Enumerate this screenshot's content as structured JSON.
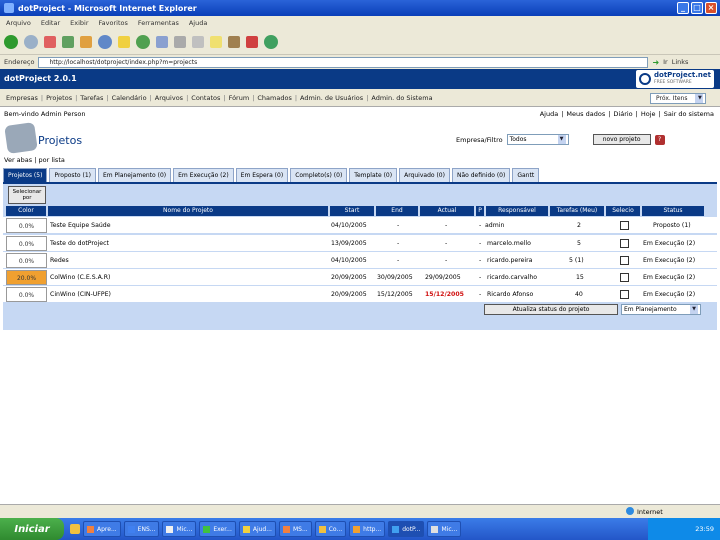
{
  "window": {
    "title": "dotProject - Microsoft Internet Explorer",
    "min": "_",
    "max": "□",
    "close": "×"
  },
  "ie_menu": [
    "Arquivo",
    "Editar",
    "Exibir",
    "Favoritos",
    "Ferramentas",
    "Ajuda"
  ],
  "address": {
    "label": "Endereço",
    "url": "http://localhost/dotproject/index.php?m=projects",
    "go": "Ir",
    "links": "Links"
  },
  "app": {
    "name": "dotProject 2.0.1",
    "logo": "dotProject.net",
    "logo_sub": "FREE SOFTWARE"
  },
  "nav": [
    "Empresas",
    "Projetos",
    "Tarefas",
    "Calendário",
    "Arquivos",
    "Contatos",
    "Fórum",
    "Chamados",
    "Admin. de Usuários",
    "Admin. do Sistema",
    "Próx. Itens"
  ],
  "user": {
    "welcome": "Bem-vindo Admin Person",
    "links": [
      "Ajuda",
      "Meus dados",
      "Diário",
      "Hoje",
      "Sair do sistema"
    ]
  },
  "page": {
    "title": "Projetos",
    "filter_label": "Empresa/Filtro",
    "filter_value": "Todos",
    "new_button": "novo projeto",
    "help": "?"
  },
  "view_line": "Ver abas | por lista",
  "tabs": [
    "Projetos (5)",
    "Proposto (1)",
    "Em Planejamento (0)",
    "Em Execução (2)",
    "Em Espera (0)",
    "Completo(s) (0)",
    "Template (0)",
    "Arquivado (0)",
    "Não definido (0)",
    "Gantt"
  ],
  "table": {
    "sort_label": "Selecionar por",
    "headers": [
      "Color",
      "Nome do Projeto",
      "Start",
      "End",
      "Actual",
      "P",
      "Responsável",
      "Tarefas (Meu)",
      "Selecio",
      "Status"
    ],
    "rows": [
      {
        "color_text": "0.0%",
        "color": "#ffffff",
        "name": "Teste Equipe Saúde",
        "start": "04/10/2005",
        "end": "-",
        "actual": "-",
        "p": "-",
        "owner": "admin",
        "tasks": "2",
        "status": "Proposto (1)"
      },
      {
        "color_text": "0.0%",
        "color": "#ffffff",
        "name": "Teste do dotProject",
        "start": "13/09/2005",
        "end": "-",
        "actual": "-",
        "p": "-",
        "owner": "marcelo.mello",
        "tasks": "5",
        "status": "Em Execução (2)"
      },
      {
        "color_text": "0.0%",
        "color": "#ffffff",
        "name": "Redes",
        "start": "04/10/2005",
        "end": "-",
        "actual": "-",
        "p": "-",
        "owner": "ricardo.pereira",
        "tasks": "5 (1)",
        "status": "Em Execução (2)"
      },
      {
        "color_text": "20.0%",
        "color": "#f0a030",
        "name": "ColWino (C.E.S.A.R)",
        "start": "20/09/2005",
        "end": "30/09/2005",
        "actual": "29/09/2005",
        "actual_red": false,
        "p": "-",
        "owner": "ricardo.carvalho",
        "tasks": "15",
        "status": "Em Execução (2)"
      },
      {
        "color_text": "0.0%",
        "color": "#ffffff",
        "name": "CinWino (CIN-UFPE)",
        "start": "20/09/2005",
        "end": "15/12/2005",
        "actual": "15/12/2005",
        "actual_red": true,
        "p": "-",
        "owner": "Ricardo Afonso",
        "tasks": "40",
        "status": "Em Execução (2)"
      }
    ],
    "update_button": "Atualiza status do projeto",
    "update_select": "Em Planejamento"
  },
  "statusbar": {
    "text": "",
    "zone": "Internet"
  },
  "taskbar": {
    "start": "Iniciar",
    "tasks": [
      "Apre...",
      "ENS...",
      "Mic...",
      "Exer...",
      "Ajud...",
      "MS...",
      "Co...",
      "http...",
      "dotP...",
      "Mic..."
    ],
    "clock": "23:59"
  },
  "colors": {
    "header": "#0a3a86",
    "accent": "#0a3a86",
    "panel": "#c6d8f3",
    "late": "#d01010"
  }
}
